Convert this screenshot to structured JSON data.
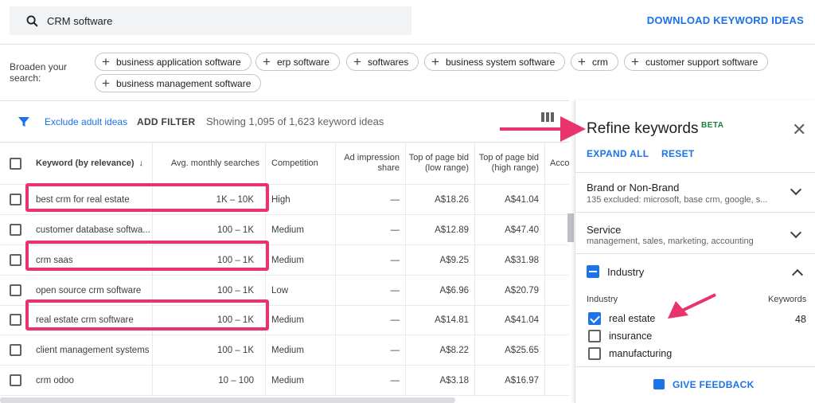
{
  "search": {
    "value": "CRM software"
  },
  "toolbar": {
    "download_label": "DOWNLOAD KEYWORD IDEAS"
  },
  "broaden": {
    "label": "Broaden your search:",
    "chips": [
      "business application software",
      "erp software",
      "softwares",
      "business system software",
      "crm",
      "customer support software",
      "business management software"
    ]
  },
  "filters": {
    "exclude_label": "Exclude adult ideas",
    "add_filter_label": "ADD FILTER",
    "showing": "Showing 1,095 of 1,623 keyword ideas"
  },
  "table": {
    "headers": [
      "Keyword (by relevance)",
      "Avg. monthly searches",
      "Competition",
      "Ad impression share",
      "Top of page bid (low range)",
      "Top of page bid (high range)",
      "Acco"
    ],
    "rows": [
      {
        "keyword": "best crm for real estate",
        "searches": "1K – 10K",
        "competition": "High",
        "impression": "—",
        "low": "A$18.26",
        "high": "A$41.04"
      },
      {
        "keyword": "customer database softwa...",
        "searches": "100 – 1K",
        "competition": "Medium",
        "impression": "—",
        "low": "A$12.89",
        "high": "A$47.40"
      },
      {
        "keyword": "crm saas",
        "searches": "100 – 1K",
        "competition": "Medium",
        "impression": "—",
        "low": "A$9.25",
        "high": "A$31.98"
      },
      {
        "keyword": "open source crm software",
        "searches": "100 – 1K",
        "competition": "Low",
        "impression": "—",
        "low": "A$6.96",
        "high": "A$20.79"
      },
      {
        "keyword": "real estate crm software",
        "searches": "100 – 1K",
        "competition": "Medium",
        "impression": "—",
        "low": "A$14.81",
        "high": "A$41.04"
      },
      {
        "keyword": "client management systems",
        "searches": "100 – 1K",
        "competition": "Medium",
        "impression": "—",
        "low": "A$8.22",
        "high": "A$25.65"
      },
      {
        "keyword": "crm odoo",
        "searches": "10 – 100",
        "competition": "Medium",
        "impression": "—",
        "low": "A$3.18",
        "high": "A$16.97"
      }
    ]
  },
  "panel": {
    "title": "Refine keywords",
    "beta": "BETA",
    "expand_all": "EXPAND ALL",
    "reset": "RESET",
    "sections": [
      {
        "title": "Brand or Non-Brand",
        "subtitle": "135 excluded: microsoft, base crm, google, s..."
      },
      {
        "title": "Service",
        "subtitle": "management, sales, marketing, accounting"
      }
    ],
    "industry": {
      "title": "Industry",
      "col_label": "Industry",
      "count_label": "Keywords",
      "options": [
        {
          "label": "real estate",
          "checked": true,
          "count": "48"
        },
        {
          "label": "insurance",
          "checked": false
        },
        {
          "label": "manufacturing",
          "checked": false
        }
      ]
    },
    "feedback": "GIVE FEEDBACK"
  },
  "colors": {
    "accent": "#1a73e8",
    "highlight": "#e8336d",
    "beta": "#188038"
  }
}
